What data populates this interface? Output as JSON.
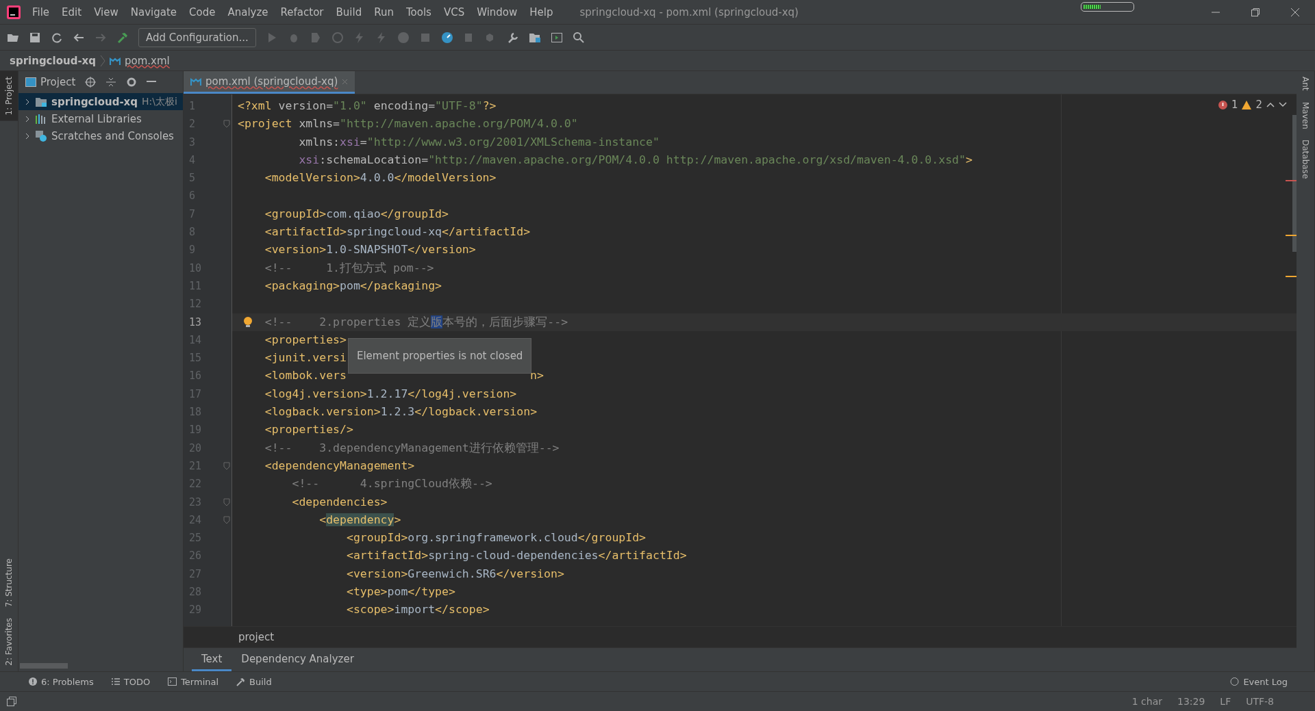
{
  "window": {
    "title": "springcloud-xq - pom.xml (springcloud-xq)",
    "memory_indicator": {
      "level": 0.35
    }
  },
  "menu": [
    "File",
    "Edit",
    "View",
    "Navigate",
    "Code",
    "Analyze",
    "Refactor",
    "Build",
    "Run",
    "Tools",
    "VCS",
    "Window",
    "Help"
  ],
  "toolbar": {
    "run_configuration": "Add Configuration..."
  },
  "breadcrumb": [
    "springcloud-xq",
    "pom.xml"
  ],
  "left_stripe": [
    "1: Project",
    "7: Structure",
    "2: Favorites"
  ],
  "right_stripe": [
    "Ant",
    "Maven",
    "Database"
  ],
  "project_panel": {
    "title": "Project",
    "items": [
      {
        "kind": "module",
        "label": "springcloud-xq",
        "path": "H:\\太极i",
        "expanded": false,
        "selected": true
      },
      {
        "kind": "libraries",
        "label": "External Libraries",
        "expanded": false,
        "selected": false
      },
      {
        "kind": "scratches",
        "label": "Scratches and Consoles",
        "expanded": false,
        "selected": false
      }
    ]
  },
  "editor_tabs": [
    {
      "label": "pom.xml (springcloud-xq)",
      "selected": true
    }
  ],
  "inspections": {
    "errors": "1",
    "warnings": "2"
  },
  "lines": [
    {
      "number": "1",
      "tokens": [
        {
          "kind": "tag",
          "text": "<?xml "
        },
        {
          "kind": "attr",
          "text": "version="
        },
        {
          "kind": "value",
          "text": "\"1.0\""
        },
        {
          "kind": "attr",
          "text": " encoding="
        },
        {
          "kind": "value",
          "text": "\"UTF-8\""
        },
        {
          "kind": "tag",
          "text": "?>"
        }
      ]
    },
    {
      "number": "2",
      "fold": true,
      "tokens": [
        {
          "kind": "tag",
          "text": "<project "
        },
        {
          "kind": "attr",
          "text": "xmlns="
        },
        {
          "kind": "value",
          "text": "\"http://maven.apache.org/POM/4.0.0\""
        }
      ]
    },
    {
      "number": "3",
      "tokens": [
        {
          "kind": "attr",
          "text": "         xmlns:"
        },
        {
          "kind": "ns",
          "text": "xsi"
        },
        {
          "kind": "attr",
          "text": "="
        },
        {
          "kind": "value",
          "text": "\"http://www.w3.org/2001/XMLSchema-instance\""
        }
      ]
    },
    {
      "number": "4",
      "tokens": [
        {
          "kind": "ns",
          "text": "         xsi"
        },
        {
          "kind": "attr",
          "text": ":schemaLocation="
        },
        {
          "kind": "value",
          "text": "\"http://maven.apache.org/POM/4.0.0 http://maven.apache.org/xsd/maven-4.0.0.xsd\""
        },
        {
          "kind": "tag",
          "text": ">"
        }
      ]
    },
    {
      "number": "5",
      "tokens": [
        {
          "kind": "tag",
          "text": "    <modelVersion>"
        },
        {
          "kind": "text",
          "text": "4.0.0"
        },
        {
          "kind": "tag",
          "text": "</modelVersion>"
        }
      ]
    },
    {
      "number": "6"
    },
    {
      "number": "7",
      "tokens": [
        {
          "kind": "tag",
          "text": "    <groupId>"
        },
        {
          "kind": "text",
          "text": "com.qiao"
        },
        {
          "kind": "tag",
          "text": "</groupId>"
        }
      ]
    },
    {
      "number": "8",
      "tokens": [
        {
          "kind": "tag",
          "text": "    <artifactId>"
        },
        {
          "kind": "text",
          "text": "springcloud-xq"
        },
        {
          "kind": "tag",
          "text": "</artifactId>"
        }
      ]
    },
    {
      "number": "9",
      "tokens": [
        {
          "kind": "tag",
          "text": "    <version>"
        },
        {
          "kind": "text",
          "text": "1.0-SNAPSHOT"
        },
        {
          "kind": "tag",
          "text": "</version>"
        }
      ]
    },
    {
      "number": "10",
      "tokens": [
        {
          "kind": "comment",
          "text": "    <!--     1.打包方式 pom-->"
        }
      ]
    },
    {
      "number": "11",
      "tokens": [
        {
          "kind": "tag",
          "text": "    <packaging>"
        },
        {
          "kind": "text",
          "text": "pom"
        },
        {
          "kind": "tag",
          "text": "</packaging>"
        }
      ]
    },
    {
      "number": "12"
    },
    {
      "number": "13",
      "current": true,
      "bulb": true,
      "tokens": [
        {
          "kind": "comment",
          "text": "    <!--    2.properties 定义"
        },
        {
          "kind": "selection",
          "text": "版"
        },
        {
          "kind": "comment",
          "text": "本号的，后面步骤写-->"
        }
      ]
    },
    {
      "number": "14",
      "tooltip": "Element properties is not closed",
      "tokens": [
        {
          "kind": "tag",
          "text": "    <properties>"
        }
      ]
    },
    {
      "number": "15",
      "tokens": [
        {
          "kind": "tag",
          "text": "    <junit.versi"
        }
      ]
    },
    {
      "number": "16",
      "tokens": [
        {
          "kind": "tag",
          "text": "    <lombok.vers"
        },
        {
          "kind": "covered"
        },
        {
          "kind": "tag",
          "text": "n>"
        }
      ]
    },
    {
      "number": "17",
      "tokens": [
        {
          "kind": "tag",
          "text": "    <log4j.version>"
        },
        {
          "kind": "text",
          "text": "1.2.17"
        },
        {
          "kind": "tag",
          "text": "</log4j.version>"
        }
      ]
    },
    {
      "number": "18",
      "tokens": [
        {
          "kind": "tag",
          "text": "    <logback.version>"
        },
        {
          "kind": "text",
          "text": "1.2.3"
        },
        {
          "kind": "tag",
          "text": "</logback.version>"
        }
      ]
    },
    {
      "number": "19",
      "tokens": [
        {
          "kind": "tag",
          "text": "    <properties/>"
        }
      ]
    },
    {
      "number": "20",
      "tokens": [
        {
          "kind": "comment",
          "text": "    <!--    3.dependencyManagement进行依赖管理-->"
        }
      ]
    },
    {
      "number": "21",
      "fold": true,
      "tokens": [
        {
          "kind": "tag",
          "text": "    <dependencyManagement>"
        }
      ]
    },
    {
      "number": "22",
      "tokens": [
        {
          "kind": "comment",
          "text": "        <!--      4.springCloud依赖-->"
        }
      ]
    },
    {
      "number": "23",
      "fold": true,
      "tokens": [
        {
          "kind": "tag",
          "text": "        <dependencies>"
        }
      ]
    },
    {
      "number": "24",
      "fold": true,
      "tokens": [
        {
          "kind": "tag",
          "text": "            <"
        },
        {
          "kind": "tag-match",
          "text": "dependency"
        },
        {
          "kind": "tag",
          "text": ">"
        }
      ]
    },
    {
      "number": "25",
      "tokens": [
        {
          "kind": "tag",
          "text": "                <groupId>"
        },
        {
          "kind": "text",
          "text": "org.springframework.cloud"
        },
        {
          "kind": "tag",
          "text": "</groupId>"
        }
      ]
    },
    {
      "number": "26",
      "tokens": [
        {
          "kind": "tag",
          "text": "                <artifactId>"
        },
        {
          "kind": "text",
          "text": "spring-cloud-dependencies"
        },
        {
          "kind": "tag",
          "text": "</artifactId>"
        }
      ]
    },
    {
      "number": "27",
      "tokens": [
        {
          "kind": "tag",
          "text": "                <version>"
        },
        {
          "kind": "text",
          "text": "Greenwich.SR6"
        },
        {
          "kind": "tag",
          "text": "</version>"
        }
      ]
    },
    {
      "number": "28",
      "tokens": [
        {
          "kind": "tag",
          "text": "                <type>"
        },
        {
          "kind": "text",
          "text": "pom"
        },
        {
          "kind": "tag",
          "text": "</type>"
        }
      ]
    },
    {
      "number": "29",
      "tokens": [
        {
          "kind": "tag",
          "text": "                <scope>"
        },
        {
          "kind": "text",
          "text": "import"
        },
        {
          "kind": "tag",
          "text": "</scope>"
        }
      ]
    }
  ],
  "editor_breadcrumb": "project",
  "bottom_tabs": [
    {
      "label": "Text",
      "selected": true
    },
    {
      "label": "Dependency Analyzer",
      "selected": false
    }
  ],
  "tool_windows": [
    {
      "kind": "problems",
      "label": "6: Problems"
    },
    {
      "kind": "todo",
      "label": "TODO"
    },
    {
      "kind": "terminal",
      "label": "Terminal"
    },
    {
      "kind": "build",
      "label": "Build"
    }
  ],
  "event_log": "Event Log",
  "status_bar": [
    "1 char",
    "13:29",
    "LF",
    "UTF-8"
  ]
}
